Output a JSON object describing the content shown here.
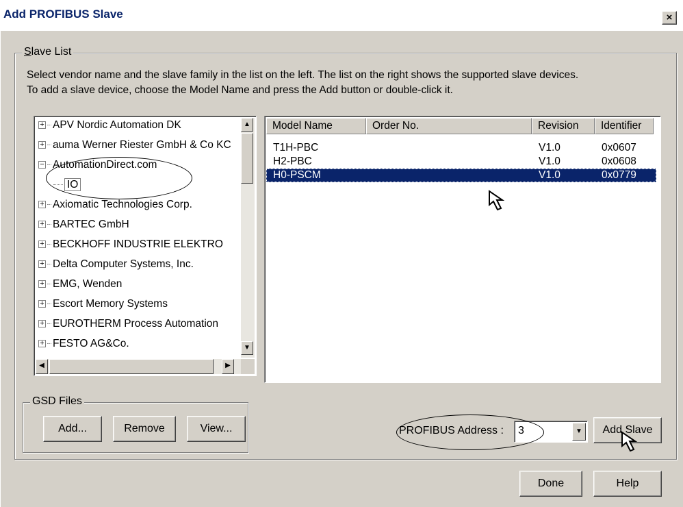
{
  "window": {
    "title": "Add PROFIBUS Slave",
    "close_glyph": "×"
  },
  "slave_list": {
    "group_label": "Slave List",
    "description_line1": "Select vendor name and the slave family in the list on the left. The list on the right shows the supported slave devices.",
    "description_line2": "To add a slave device, choose the Model Name and press the Add button or double-click it."
  },
  "vendor_tree": {
    "items": [
      {
        "label": "APV Nordic Automation DK",
        "expander": "+",
        "icon": "expand-plus-icon"
      },
      {
        "label": "auma Werner Riester GmbH & Co KC",
        "expander": "+",
        "icon": "expand-plus-icon"
      },
      {
        "label": "AutomationDirect.com",
        "expander": "−",
        "icon": "collapse-minus-icon"
      },
      {
        "label": "IO",
        "child": true
      },
      {
        "label": "Axiomatic Technologies Corp.",
        "expander": "+",
        "icon": "expand-plus-icon"
      },
      {
        "label": "BARTEC GmbH",
        "expander": "+",
        "icon": "expand-plus-icon"
      },
      {
        "label": "BECKHOFF INDUSTRIE ELEKTRO",
        "expander": "+",
        "icon": "expand-plus-icon"
      },
      {
        "label": "Delta Computer Systems, Inc.",
        "expander": "+",
        "icon": "expand-plus-icon"
      },
      {
        "label": "EMG, Wenden",
        "expander": "+",
        "icon": "expand-plus-icon"
      },
      {
        "label": "Escort Memory Systems",
        "expander": "+",
        "icon": "expand-plus-icon"
      },
      {
        "label": "EUROTHERM Process Automation",
        "expander": "+",
        "icon": "expand-plus-icon"
      },
      {
        "label": "FESTO AG&Co.",
        "expander": "+",
        "icon": "expand-plus-icon"
      }
    ]
  },
  "slave_table": {
    "columns": [
      "Model Name",
      "Order No.",
      "Revision",
      "Identifier"
    ],
    "rows": [
      {
        "model": "T1H-PBC",
        "order": "",
        "revision": "V1.0",
        "identifier": "0x0607",
        "selected": false
      },
      {
        "model": "H2-PBC",
        "order": "",
        "revision": "V1.0",
        "identifier": "0x0608",
        "selected": false
      },
      {
        "model": "H0-PSCM",
        "order": "",
        "revision": "V1.0",
        "identifier": "0x0779",
        "selected": true
      }
    ]
  },
  "gsd_files": {
    "group_label": "GSD Files",
    "add_label": "Add...",
    "remove_label": "Remove",
    "view_label": "View..."
  },
  "address": {
    "label": "PROFIBUS Address :",
    "value": "3"
  },
  "buttons": {
    "add_slave": "Add Slave",
    "done": "Done",
    "help": "Help"
  },
  "scroll_arrows": {
    "up": "▲",
    "down": "▼",
    "left": "◀",
    "right": "▶"
  },
  "colors": {
    "dialog_face": "#d4d0c8",
    "title_text": "#0a246a",
    "selection": "#0a246a"
  }
}
